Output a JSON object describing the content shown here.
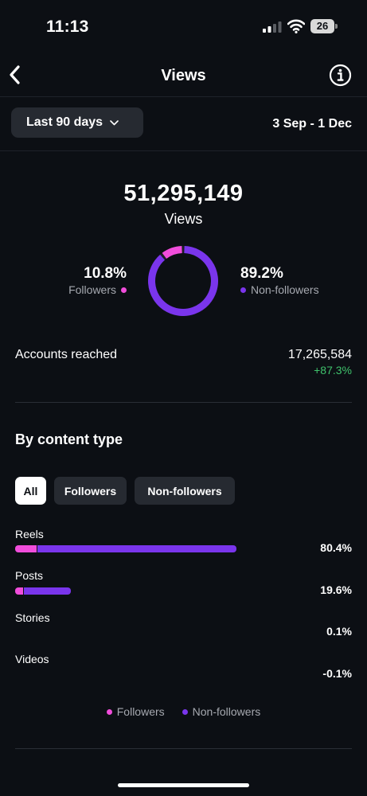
{
  "status_bar": {
    "time": "11:13",
    "battery": "26"
  },
  "header": {
    "title": "Views"
  },
  "filter": {
    "period_label": "Last 90 days",
    "date_range": "3 Sep - 1 Dec"
  },
  "summary": {
    "total_views": "51,295,149",
    "views_label": "Views",
    "followers_pct": "10.8%",
    "followers_label": "Followers",
    "nonfollowers_pct": "89.2%",
    "nonfollowers_label": "Non-followers"
  },
  "reach": {
    "label": "Accounts reached",
    "value": "17,265,584",
    "change": "+87.3%"
  },
  "content_type": {
    "title": "By content type",
    "tabs": [
      {
        "label": "All",
        "selected": true
      },
      {
        "label": "Followers",
        "selected": false
      },
      {
        "label": "Non-followers",
        "selected": false
      }
    ],
    "rows": [
      {
        "label": "Reels",
        "percent": "80.4%"
      },
      {
        "label": "Posts",
        "percent": "19.6%"
      },
      {
        "label": "Stories",
        "percent": "0.1%"
      },
      {
        "label": "Videos",
        "percent": "-0.1%"
      }
    ],
    "legend": {
      "followers": "Followers",
      "nonfollowers": "Non-followers"
    }
  },
  "colors": {
    "followers": "#f14ddb",
    "nonfollowers": "#7a35ec",
    "positive": "#3fc26c",
    "background": "#0c0f14"
  },
  "icons": [
    "back-icon",
    "info-icon",
    "chevron-down-icon",
    "signal-icon",
    "wifi-icon",
    "battery-icon"
  ],
  "chart_data": {
    "type": "pie",
    "categories": [
      "Followers",
      "Non-followers"
    ],
    "values": [
      10.8,
      89.2
    ]
  }
}
